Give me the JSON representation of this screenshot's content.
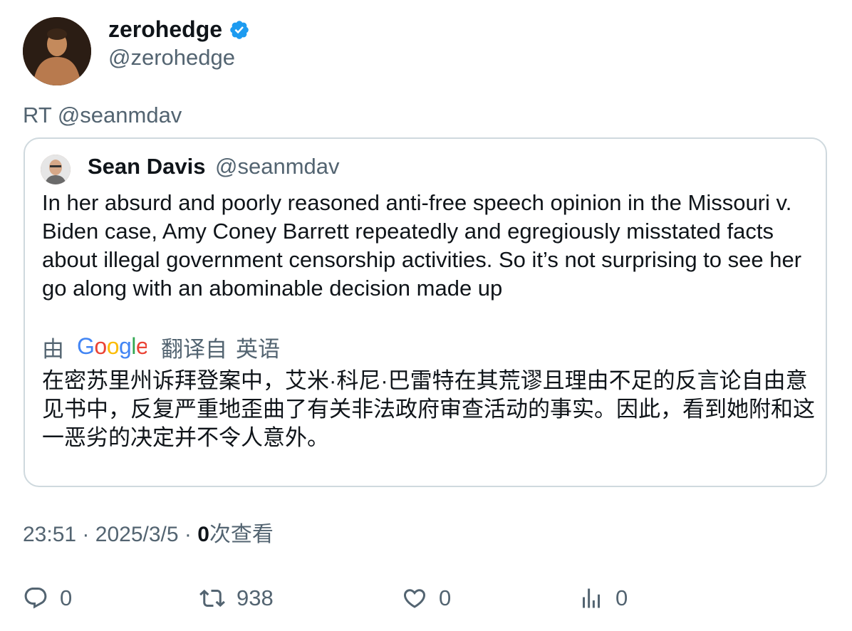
{
  "author": {
    "display_name": "zerohedge",
    "handle": "@zerohedge",
    "verified_icon": "verified-badge-icon",
    "verified_color": "#1d9bf0"
  },
  "retweet": {
    "label": "RT @seanmdav"
  },
  "quoted": {
    "display_name": "Sean Davis",
    "handle": "@seanmdav",
    "text": "In her absurd and poorly reasoned anti-free speech opinion in the Missouri v. Biden case, Amy Coney Barrett repeatedly and egregiously misstated facts about illegal government censorship activities. So it’s not surprising to see her go along with an abominable decision made up",
    "translation": {
      "by_label": "由",
      "provider": "Google",
      "from_label": "翻译自",
      "language": "英语",
      "text": "在密苏里州诉拜登案中，艾米·科尼·巴雷特在其荒谬且理由不足的反言论自由意见书中，反复严重地歪曲了有关非法政府审查活动的事实。因此，看到她附和这一恶劣的决定并不令人意外。"
    }
  },
  "meta": {
    "time": "23:51",
    "date": "2025/3/5",
    "views_count": "0",
    "views_label": "次查看",
    "separator": "·"
  },
  "actions": {
    "reply_count": "0",
    "retweet_count": "938",
    "like_count": "0",
    "views_count": "0"
  },
  "colors": {
    "text_primary": "#0f1419",
    "text_secondary": "#536471",
    "border": "#cfd9de"
  }
}
